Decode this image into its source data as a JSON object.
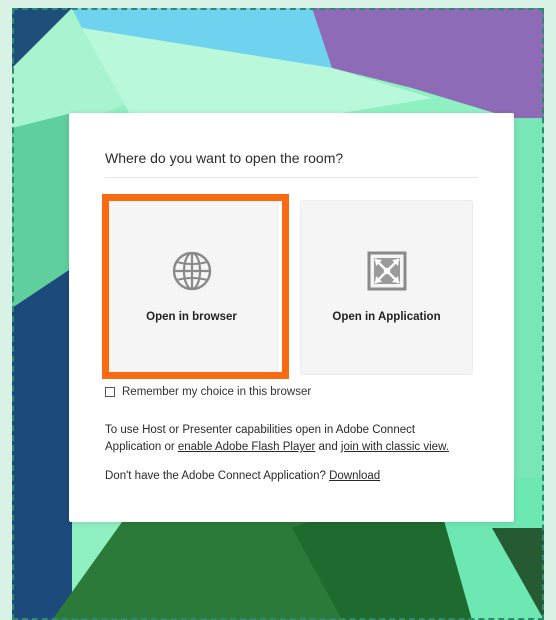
{
  "dialog": {
    "title": "Where do you want to open the room?",
    "options": [
      {
        "label": "Open in browser",
        "icon": "globe-icon",
        "selected": true
      },
      {
        "label": "Open in Application",
        "icon": "application-icon",
        "selected": false
      }
    ],
    "remember_label": "Remember my choice in this browser",
    "remember_checked": false,
    "info": {
      "line1": "To use Host or Presenter capabilities open in Adobe Connect",
      "line2_prefix": "Application or ",
      "flash_link": "enable Adobe Flash Player",
      "and_text": " and ",
      "classic_link": "join with classic view."
    },
    "download": {
      "prefix": "Don't have the Adobe Connect Application? ",
      "link": "Download"
    }
  },
  "colors": {
    "selected_outline": "#fa6a12",
    "frame_border": "#2e8a6e"
  }
}
